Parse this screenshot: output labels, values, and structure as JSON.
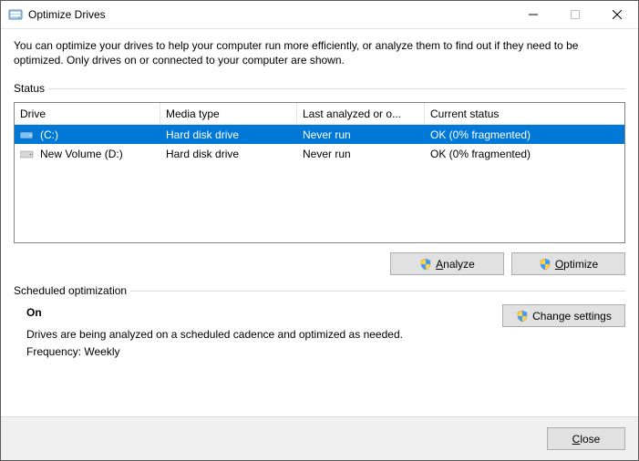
{
  "window": {
    "title": "Optimize Drives"
  },
  "intro": "You can optimize your drives to help your computer run more efficiently, or analyze them to find out if they need to be optimized. Only drives on or connected to your computer are shown.",
  "section_status": "Status",
  "columns": {
    "drive": "Drive",
    "media": "Media type",
    "last": "Last analyzed or o...",
    "status": "Current status"
  },
  "rows": [
    {
      "drive": "(C:)",
      "media": "Hard disk drive",
      "last": "Never run",
      "status": "OK (0% fragmented)",
      "selected": true,
      "icon": "drive-c"
    },
    {
      "drive": "New Volume (D:)",
      "media": "Hard disk drive",
      "last": "Never run",
      "status": "OK (0% fragmented)",
      "selected": false,
      "icon": "drive-d"
    }
  ],
  "buttons": {
    "analyze": "Analyze",
    "optimize": "Optimize",
    "change_settings": "Change settings",
    "close": "Close"
  },
  "section_sched": "Scheduled optimization",
  "sched": {
    "on": "On",
    "desc": "Drives are being analyzed on a scheduled cadence and optimized as needed.",
    "freq": "Frequency: Weekly"
  }
}
